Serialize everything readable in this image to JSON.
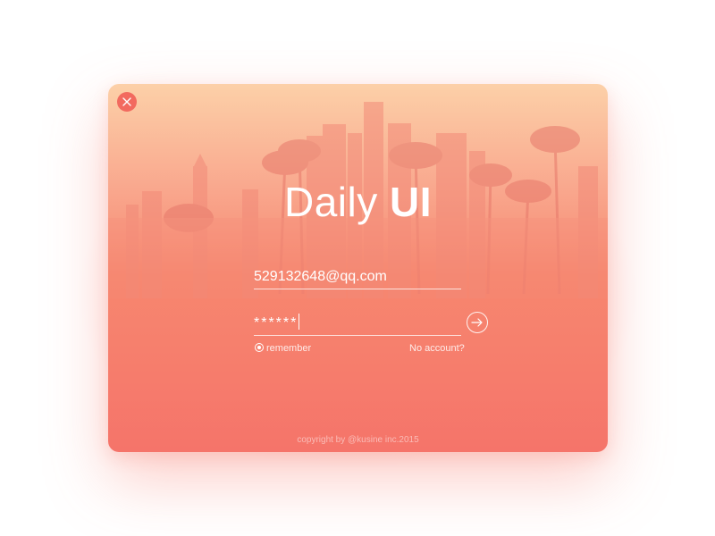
{
  "window": {
    "title_light": "Daily",
    "title_bold": "UI"
  },
  "form": {
    "email_value": "529132648@qq.com",
    "password_value": "******",
    "remember_label": "remember",
    "no_account_label": "No account?"
  },
  "footer": {
    "copyright": "copyright by @kusine inc.2015"
  },
  "icons": {
    "close": "close-icon",
    "submit": "arrow-right-icon",
    "remember": "radio-icon",
    "background": "city-skyline-palm-trees"
  },
  "colors": {
    "accent": "#f26a5f",
    "gradient_top": "#fcd0a8",
    "gradient_bottom": "#f5746a",
    "text": "#ffffff"
  }
}
